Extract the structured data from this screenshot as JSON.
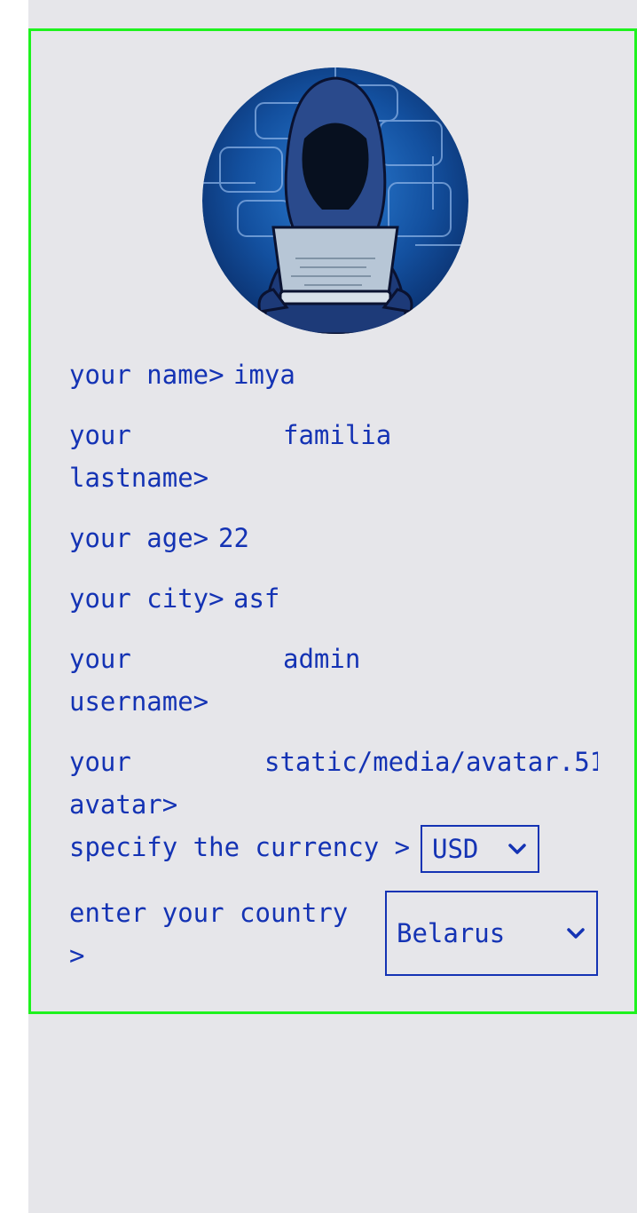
{
  "profile": {
    "name_label": "your name>",
    "name_value": "imya",
    "lastname_label_1": "your",
    "lastname_label_2": "lastname>",
    "lastname_value": "familia",
    "age_label": "your age>",
    "age_value": "22",
    "city_label": "your city>",
    "city_value": "asf",
    "username_label_1": "your",
    "username_label_2": "username>",
    "username_value": "admin",
    "avatar_label_1": "your",
    "avatar_label_2": "avatar>",
    "avatar_value": "static/media/avatar.51",
    "currency_label": "specify the currency >",
    "currency_selected": "USD",
    "country_label_1": "enter your country",
    "country_label_2": ">",
    "country_selected": "Belarus"
  },
  "icons": {
    "avatar": "hooded-hacker-with-laptop-image",
    "dropdown": "chevron-down-icon"
  },
  "colors": {
    "text": "#1433b4",
    "border_highlight": "#1ef21e",
    "background": "#e6e6ea"
  }
}
